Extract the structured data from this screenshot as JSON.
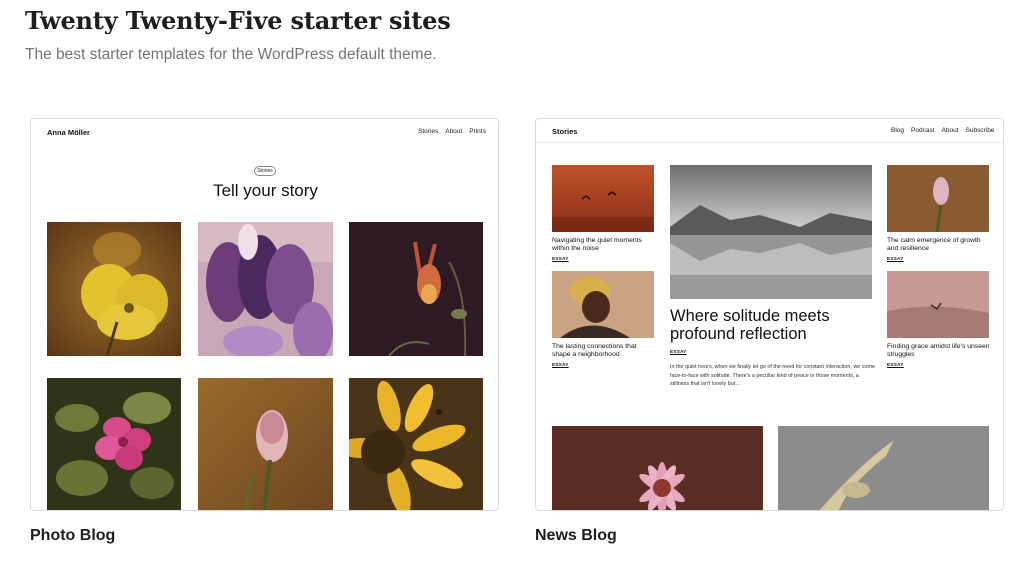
{
  "header": {
    "title": "Twenty Twenty-Five starter sites",
    "subtitle": "The best starter templates for the WordPress default theme."
  },
  "cards": [
    {
      "caption": "Photo Blog",
      "site_name": "Anna Möller",
      "nav": [
        "Stories",
        "About",
        "Prints"
      ],
      "pill": "Stories",
      "hero_title": "Tell your story"
    },
    {
      "caption": "News Blog",
      "site_name": "Stories",
      "nav": [
        "Blog",
        "Podcast",
        "About",
        "Subscribe"
      ],
      "posts": [
        {
          "title": "Navigating the quiet moments within the noise",
          "tag": "ESSAY"
        },
        {
          "title": "The lasting connections that shape a neighborhood",
          "tag": "ESSAY"
        },
        {
          "title": "The calm emergence of growth and resilience",
          "tag": "ESSAY"
        },
        {
          "title": "Finding grace amidst life's unseen struggles",
          "tag": "ESSAY"
        }
      ],
      "feature": {
        "title": "Where solitude meets profound reflection",
        "tag": "ESSAY",
        "excerpt": "In the quiet hours, when we finally let go of the need for constant interaction, we come face-to-face with solitude. There's a peculiar kind of peace in those moments, a stillness that isn't lonely but…"
      }
    }
  ]
}
